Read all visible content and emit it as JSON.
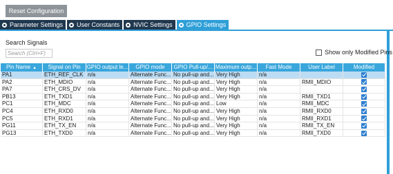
{
  "toolbar": {
    "reset_label": "Reset Configuration"
  },
  "tabs": [
    {
      "label": "Parameter Settings",
      "active": false
    },
    {
      "label": "User Constants",
      "active": false
    },
    {
      "label": "NVIC Settings",
      "active": false
    },
    {
      "label": "GPIO Settings",
      "active": true
    }
  ],
  "search": {
    "title": "Search Signals",
    "placeholder": "Search (Ctrl+F)"
  },
  "filter": {
    "show_modified_label": "Show only Modified Pins",
    "checked": false
  },
  "table": {
    "headers": [
      "Pin Name",
      "Signal on Pin",
      "GPIO output le...",
      "GPIO mode",
      "GPIO Pull-up/...",
      "Maximum outp...",
      "Fast Mode",
      "User Label",
      "Modified"
    ],
    "sort_icon": "sort-up-icon",
    "rows": [
      {
        "pin": "PA1",
        "signal": "ETH_REF_CLK",
        "output": "n/a",
        "mode": "Alternate Func...",
        "pull": "No pull-up and...",
        "speed": "Very High",
        "fast": "n/a",
        "label": "",
        "modified": true,
        "selected": true
      },
      {
        "pin": "PA2",
        "signal": "ETH_MDIO",
        "output": "n/a",
        "mode": "Alternate Func...",
        "pull": "No pull-up and...",
        "speed": "Very High",
        "fast": "n/a",
        "label": "RMII_MDIO",
        "modified": true
      },
      {
        "pin": "PA7",
        "signal": "ETH_CRS_DV",
        "output": "n/a",
        "mode": "Alternate Func...",
        "pull": "No pull-up and...",
        "speed": "Very High",
        "fast": "n/a",
        "label": "",
        "modified": true
      },
      {
        "pin": "PB13",
        "signal": "ETH_TXD1",
        "output": "n/a",
        "mode": "Alternate Func...",
        "pull": "No pull-up and...",
        "speed": "Very High",
        "fast": "n/a",
        "label": "RMII_TXD1",
        "modified": true
      },
      {
        "pin": "PC1",
        "signal": "ETH_MDC",
        "output": "n/a",
        "mode": "Alternate Func...",
        "pull": "No pull-up and...",
        "speed": "Low",
        "fast": "n/a",
        "label": "RMII_MDC",
        "modified": true
      },
      {
        "pin": "PC4",
        "signal": "ETH_RXD0",
        "output": "n/a",
        "mode": "Alternate Func...",
        "pull": "No pull-up and...",
        "speed": "Very High",
        "fast": "n/a",
        "label": "RMII_RXD0",
        "modified": true
      },
      {
        "pin": "PC5",
        "signal": "ETH_RXD1",
        "output": "n/a",
        "mode": "Alternate Func...",
        "pull": "No pull-up and...",
        "speed": "Very High",
        "fast": "n/a",
        "label": "RMII_RXD1",
        "modified": true
      },
      {
        "pin": "PG11",
        "signal": "ETH_TX_EN",
        "output": "n/a",
        "mode": "Alternate Func...",
        "pull": "No pull-up and...",
        "speed": "Very High",
        "fast": "n/a",
        "label": "RMII_TX_EN",
        "modified": true
      },
      {
        "pin": "PG13",
        "signal": "ETH_TXD0",
        "output": "n/a",
        "mode": "Alternate Func...",
        "pull": "No pull-up and...",
        "speed": "Very High",
        "fast": "n/a",
        "label": "RMII_TXD0",
        "modified": true
      }
    ]
  },
  "colors": {
    "accent": "#2f9fd8",
    "tab_inactive": "#20384f",
    "header_bg": "#3aa7dc",
    "selected_row": "#bcdcf3",
    "checkbox": "#2f7fd0",
    "reset_button": "#8e9499"
  }
}
